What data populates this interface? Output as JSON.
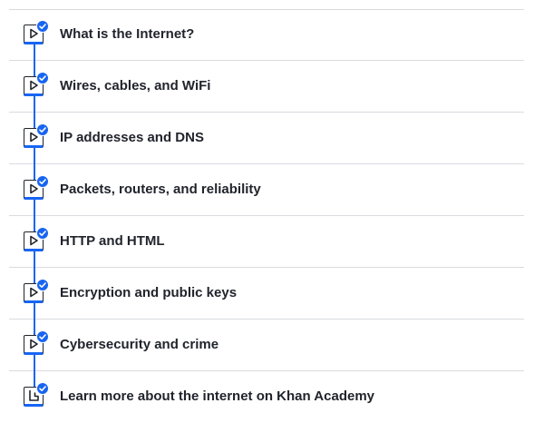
{
  "lessons": [
    {
      "title": "What is the Internet?",
      "icon": "play-video-icon",
      "completed": true
    },
    {
      "title": "Wires, cables, and WiFi",
      "icon": "play-video-icon",
      "completed": true
    },
    {
      "title": "IP addresses and DNS",
      "icon": "play-video-icon",
      "completed": true
    },
    {
      "title": "Packets, routers, and reliability",
      "icon": "play-video-icon",
      "completed": true
    },
    {
      "title": "HTTP and HTML",
      "icon": "play-video-icon",
      "completed": true
    },
    {
      "title": "Encryption and public keys",
      "icon": "play-video-icon",
      "completed": true
    },
    {
      "title": "Cybersecurity and crime",
      "icon": "play-video-icon",
      "completed": true
    },
    {
      "title": "Learn more about the internet on Khan Academy",
      "icon": "article-icon",
      "completed": true
    }
  ],
  "colors": {
    "accent": "#1865f2",
    "text": "#21242c",
    "divider": "#dadbdf"
  }
}
